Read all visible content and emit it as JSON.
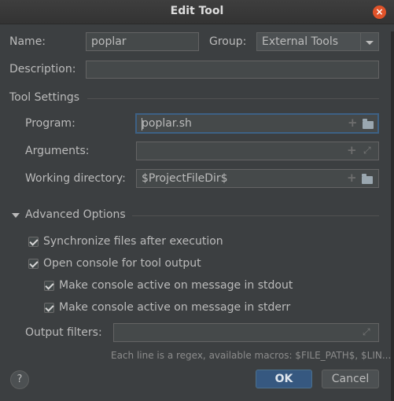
{
  "window": {
    "title": "Edit Tool"
  },
  "name": {
    "label": "Name:",
    "value": "poplar"
  },
  "group": {
    "label": "Group:",
    "value": "External Tools"
  },
  "description": {
    "label": "Description:",
    "value": ""
  },
  "tool_settings": {
    "title": "Tool Settings",
    "program": {
      "label": "Program:",
      "value": "poplar.sh"
    },
    "arguments": {
      "label": "Arguments:",
      "value": ""
    },
    "working_directory": {
      "label": "Working directory:",
      "value": "$ProjectFileDir$"
    }
  },
  "advanced": {
    "title": "Advanced Options",
    "sync_files": {
      "label": "Synchronize files after execution",
      "checked": true
    },
    "open_console": {
      "label": "Open console for tool output",
      "checked": true
    },
    "active_stdout": {
      "label": "Make console active on message in stdout",
      "checked": true
    },
    "active_stderr": {
      "label": "Make console active on message in stderr",
      "checked": true
    },
    "output_filters": {
      "label": "Output filters:",
      "value": ""
    },
    "hint": "Each line is a regex, available macros: $FILE_PATH$, $LIN..."
  },
  "buttons": {
    "help": "?",
    "ok": "OK",
    "cancel": "Cancel"
  },
  "colors": {
    "background": "#3c3f41",
    "accent": "#365880",
    "focus": "#3d6185",
    "close": "#e0532a"
  },
  "icons": [
    "close-icon",
    "dropdown-arrow-icon",
    "plus-icon",
    "folder-icon",
    "expand-icon",
    "collapse-triangle-icon",
    "checkmark-icon",
    "help-icon"
  ]
}
